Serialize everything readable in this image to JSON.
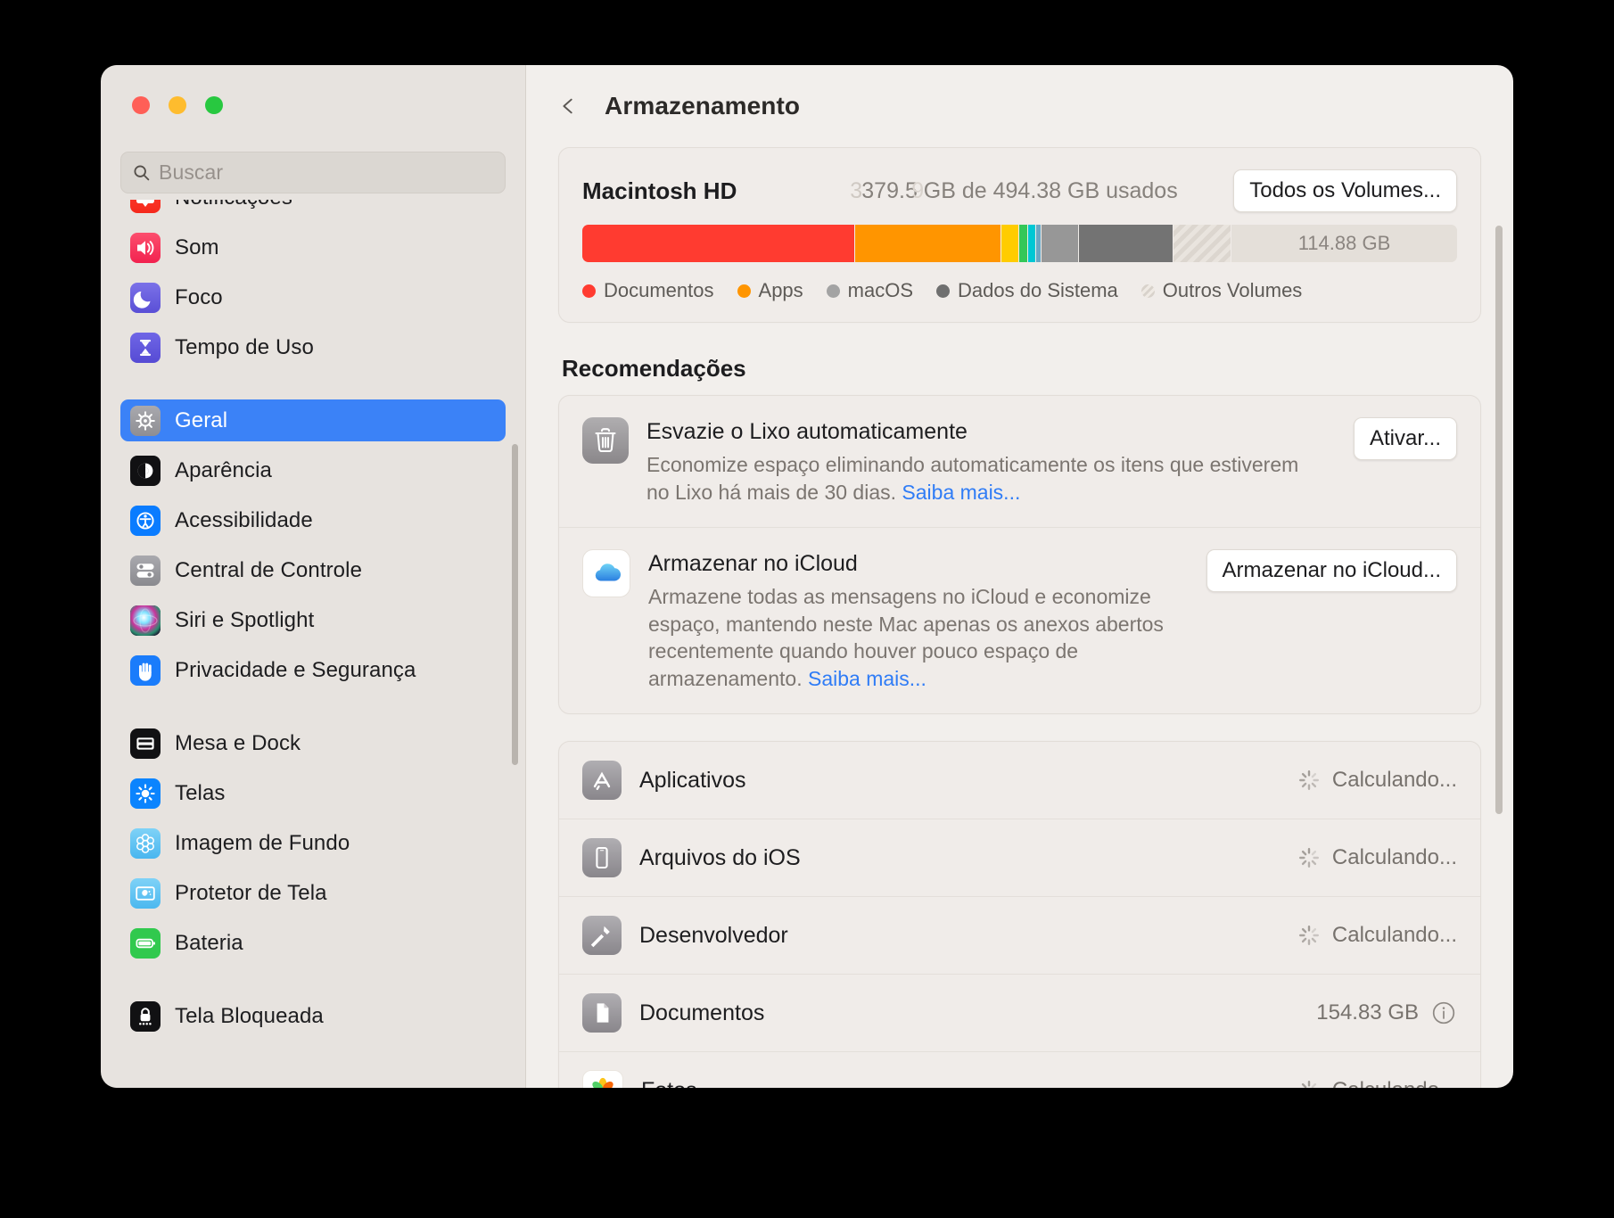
{
  "window": {
    "traffic_lights": [
      {
        "name": "close",
        "color": "#ff5f57"
      },
      {
        "name": "minimize",
        "color": "#febc2e"
      },
      {
        "name": "zoom",
        "color": "#28c840"
      }
    ]
  },
  "search": {
    "placeholder": "Buscar",
    "value": ""
  },
  "sidebar": {
    "groups": [
      {
        "items": [
          {
            "label": "Notificações",
            "icon": "notifications-icon",
            "selected": false,
            "clipped": true
          },
          {
            "label": "Som",
            "icon": "sound-icon",
            "selected": false
          },
          {
            "label": "Foco",
            "icon": "focus-icon",
            "selected": false
          },
          {
            "label": "Tempo de Uso",
            "icon": "screen-time-icon",
            "selected": false
          }
        ]
      },
      {
        "items": [
          {
            "label": "Geral",
            "icon": "general-gear-icon",
            "selected": true
          },
          {
            "label": "Aparência",
            "icon": "appearance-icon",
            "selected": false
          },
          {
            "label": "Acessibilidade",
            "icon": "accessibility-icon",
            "selected": false
          },
          {
            "label": "Central de Controle",
            "icon": "control-center-icon",
            "selected": false
          },
          {
            "label": "Siri e Spotlight",
            "icon": "siri-icon",
            "selected": false
          },
          {
            "label": "Privacidade e Segurança",
            "icon": "privacy-hand-icon",
            "selected": false
          }
        ]
      },
      {
        "items": [
          {
            "label": "Mesa e Dock",
            "icon": "desktop-dock-icon",
            "selected": false
          },
          {
            "label": "Telas",
            "icon": "displays-icon",
            "selected": false
          },
          {
            "label": "Imagem de Fundo",
            "icon": "wallpaper-icon",
            "selected": false
          },
          {
            "label": "Protetor de Tela",
            "icon": "screensaver-icon",
            "selected": false
          },
          {
            "label": "Bateria",
            "icon": "battery-icon",
            "selected": false
          }
        ]
      },
      {
        "items": [
          {
            "label": "Tela Bloqueada",
            "icon": "lock-screen-icon",
            "selected": false
          }
        ]
      }
    ]
  },
  "header": {
    "back_label": "Voltar",
    "title": "Armazenamento"
  },
  "volume": {
    "name": "Macintosh HD",
    "usage_text": "379.5 GB de 494.38 GB usados",
    "usage_ghost_prefix": "3",
    "usage_ghost_mid": "9",
    "used_gb": 379.5,
    "total_gb": 494.38,
    "free_label": "114.88 GB",
    "all_volumes_button": "Todos os Volumes...",
    "segments": [
      {
        "name": "Documentos",
        "color": "#ff3b30",
        "percent": 31.1
      },
      {
        "name": "Apps",
        "color": "#ff9500",
        "percent": 16.6
      },
      {
        "name": "Amarelo",
        "color": "#ffcc00",
        "percent": 1.9
      },
      {
        "name": "Verde",
        "color": "#34c759",
        "percent": 1.0
      },
      {
        "name": "Ciano",
        "color": "#00c7d4",
        "percent": 0.8
      },
      {
        "name": "Azul Claro",
        "color": "#6aa7c4",
        "percent": 0.5
      },
      {
        "name": "macOS",
        "color": "#979797",
        "percent": 4.2
      },
      {
        "name": "Dados do Sistema",
        "color": "#737373",
        "percent": 10.7
      },
      {
        "name": "Outros Volumes",
        "color": "hatched",
        "percent": 6.5
      }
    ],
    "legend": [
      {
        "label": "Documentos",
        "color": "#ff3b30",
        "style": "dot"
      },
      {
        "label": "Apps",
        "color": "#ff9500",
        "style": "dot"
      },
      {
        "label": "macOS",
        "color": "#a3a3a3",
        "style": "dot"
      },
      {
        "label": "Dados do Sistema",
        "color": "#6f6f6f",
        "style": "dot"
      },
      {
        "label": "Outros Volumes",
        "color": "#d8d2cb",
        "style": "hatch"
      }
    ]
  },
  "recommendations": {
    "title": "Recomendações",
    "items": [
      {
        "icon": "trash-icon",
        "title": "Esvazie o Lixo automaticamente",
        "description": "Economize espaço eliminando automaticamente os itens que estiverem no Lixo há mais de 30 dias. ",
        "link": "Saiba mais...",
        "button": "Ativar..."
      },
      {
        "icon": "icloud-icon",
        "title": "Armazenar no iCloud",
        "description": "Armazene todas as mensagens no iCloud e economize espaço, mantendo neste Mac apenas os anexos abertos recentemente quando houver pouco espaço de armazenamento. ",
        "link": "Saiba mais...",
        "button": "Armazenar no iCloud..."
      }
    ]
  },
  "categories": [
    {
      "icon": "app-store-icon",
      "name": "Aplicativos",
      "value": "Calculando...",
      "state": "calculating"
    },
    {
      "icon": "ios-files-icon",
      "name": "Arquivos do iOS",
      "value": "Calculando...",
      "state": "calculating"
    },
    {
      "icon": "developer-hammer-icon",
      "name": "Desenvolvedor",
      "value": "Calculando...",
      "state": "calculating"
    },
    {
      "icon": "documents-file-icon",
      "name": "Documentos",
      "value": "154.83 GB",
      "state": "done"
    },
    {
      "icon": "photos-icon",
      "name": "Fotos",
      "value": "Calculando...",
      "state": "calculating"
    }
  ],
  "colors": {
    "accent": "#3b82f7",
    "link": "#2f7cf6",
    "sidebar_bg": "#e7e3df",
    "detail_bg": "#f2efec",
    "card_bg": "#f0ece9"
  }
}
